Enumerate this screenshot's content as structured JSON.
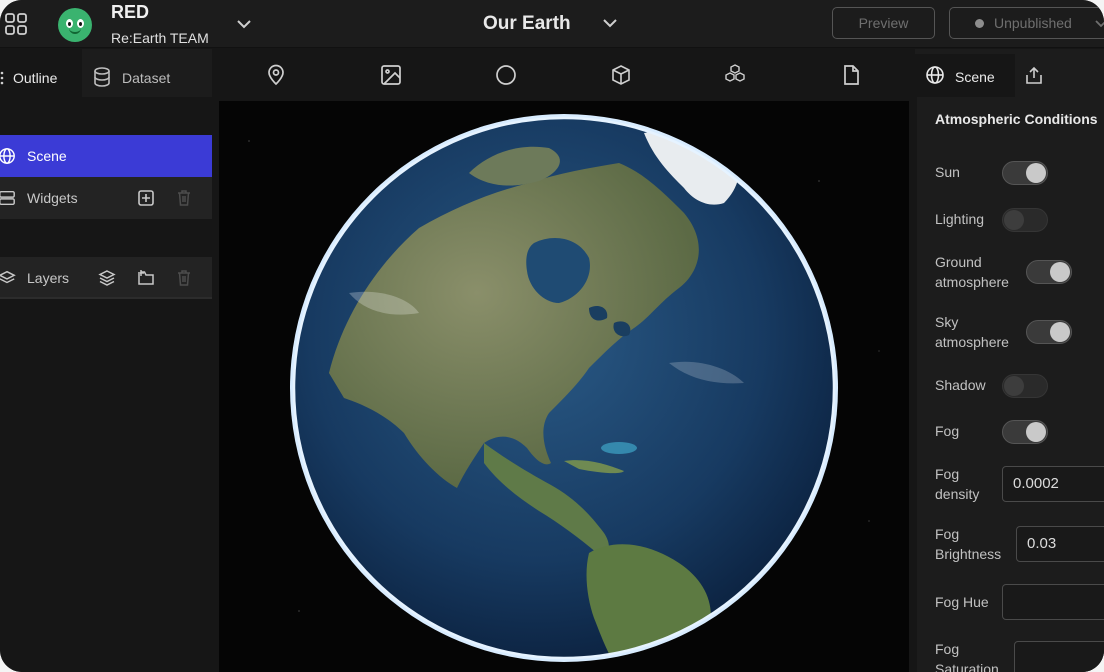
{
  "header": {
    "project_name": "RED",
    "team_name": "Re:Earth TEAM",
    "title": "Our Earth",
    "preview_label": "Preview",
    "publish_label": "Unpublished"
  },
  "left_tabs": {
    "outline": "Outline",
    "dataset": "Dataset"
  },
  "outline": {
    "scene": "Scene",
    "widgets": "Widgets",
    "layers": "Layers"
  },
  "toolbar": {
    "icons": [
      "map-pin-icon",
      "image-icon",
      "circle-icon",
      "cube-icon",
      "cubes-icon",
      "file-icon"
    ]
  },
  "right_tabs": {
    "scene": "Scene"
  },
  "properties": {
    "section_title": "Atmospheric Conditions",
    "sun": {
      "label": "Sun",
      "on": true
    },
    "lighting": {
      "label": "Lighting",
      "on": false
    },
    "ground_atmosphere": {
      "label1": "Ground",
      "label2": "atmosphere",
      "on": true
    },
    "sky_atmosphere": {
      "label1": "Sky",
      "label2": "atmosphere",
      "on": true
    },
    "shadow": {
      "label": "Shadow",
      "on": false
    },
    "fog": {
      "label": "Fog",
      "on": true
    },
    "fog_density": {
      "label1": "Fog",
      "label2": "density",
      "value": "0.0002"
    },
    "fog_brightness": {
      "label1": "Fog",
      "label2": "Brightness",
      "value": "0.03"
    },
    "fog_hue": {
      "label": "Fog Hue",
      "value": ""
    },
    "fog_saturation": {
      "label1": "Fog",
      "label2": "Saturation",
      "value": ""
    }
  },
  "colors": {
    "accent": "#3b3bd6",
    "background": "#161616",
    "panel": "#1c1c1c"
  }
}
